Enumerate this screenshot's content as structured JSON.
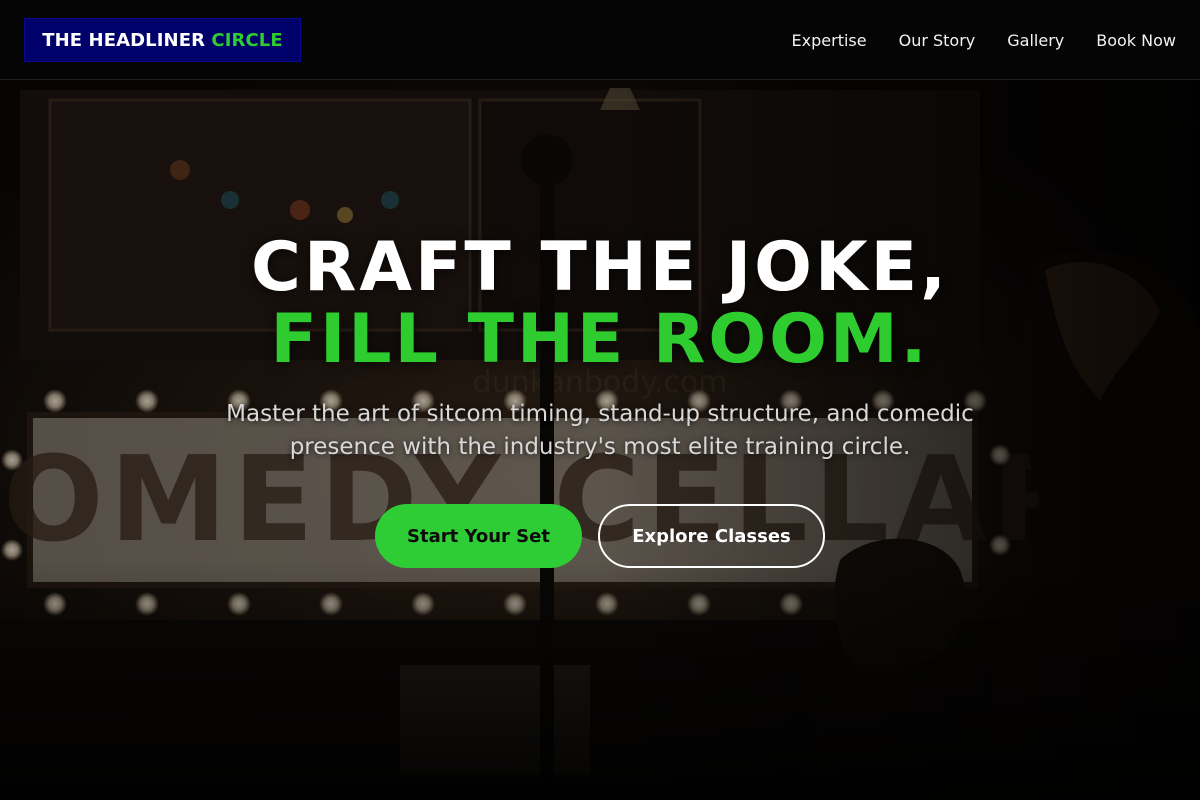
{
  "header": {
    "logo_main": "THE HEADLINER",
    "logo_accent": "CIRCLE",
    "nav": [
      {
        "label": "Expertise"
      },
      {
        "label": "Our Story"
      },
      {
        "label": "Gallery"
      },
      {
        "label": "Book Now"
      }
    ]
  },
  "hero": {
    "headline_line1": "CRAFT THE JOKE,",
    "headline_line2": "FILL THE ROOM.",
    "subtitle": "Master the art of sitcom timing, stand-up structure, and comedic presence with the industry's most elite training circle.",
    "primary_cta": "Start Your Set",
    "secondary_cta": "Explore Classes",
    "background_image": "comedy-club-marquee-photo",
    "marquee_sign_text": "COMEDY CELLAR"
  },
  "colors": {
    "accent_green": "#2ecc2e",
    "logo_background": "#00006b",
    "header_background": "#050505"
  }
}
